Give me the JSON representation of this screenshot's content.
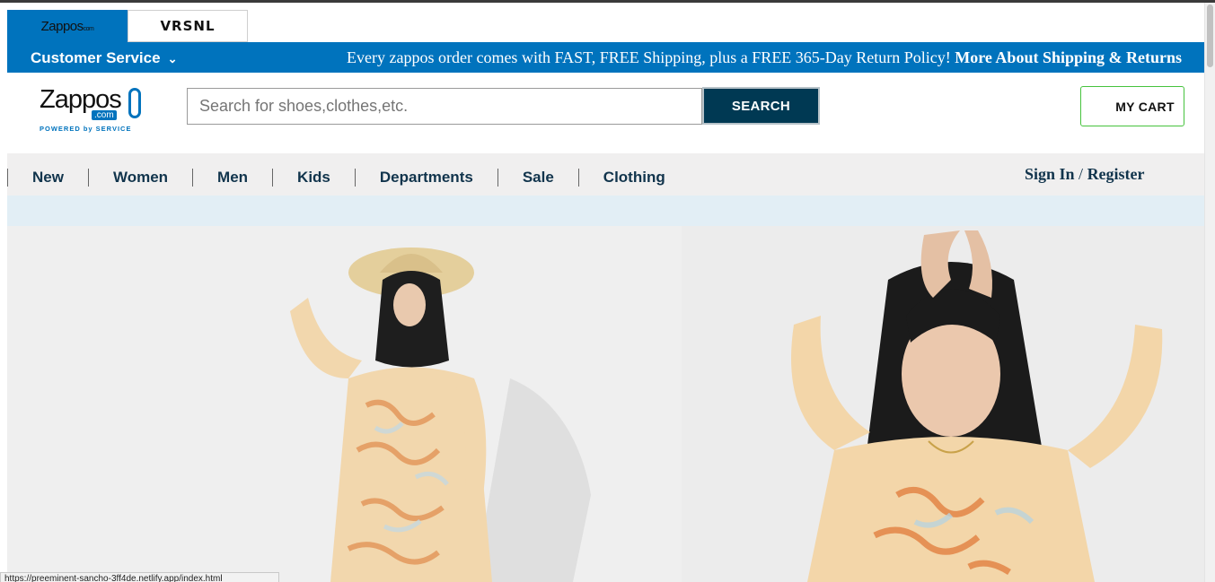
{
  "brand_tabs": {
    "zappos_label": "Zappos",
    "zappos_sub": "com",
    "vrsnl_label": "VRSNL"
  },
  "top_bar": {
    "customer_service": "Customer Service",
    "promo_text": "Every zappos order comes with FAST, FREE Shipping, plus a FREE 365-Day Return Policy!",
    "promo_link": "More About Shipping & Returns"
  },
  "header": {
    "logo_word": "Zappos",
    "logo_dotcom": ".com",
    "logo_tagline": "POWERED by SERVICE",
    "search_placeholder": "Search for shoes,clothes,etc.",
    "search_button": "SEARCH",
    "cart_label": "MY CART"
  },
  "nav": {
    "items": [
      "New",
      "Women",
      "Men",
      "Kids",
      "Departments",
      "Sale",
      "Clothing"
    ],
    "sign_in": "Sign In",
    "separator": "/",
    "register": "Register"
  },
  "status_bar": {
    "url": "https://preeminent-sancho-3ff4de.netlify.app/index.html"
  },
  "colors": {
    "brand_blue": "#0073bd",
    "search_button": "#003953",
    "nav_text": "#11344c",
    "cart_border": "#46c33d"
  }
}
